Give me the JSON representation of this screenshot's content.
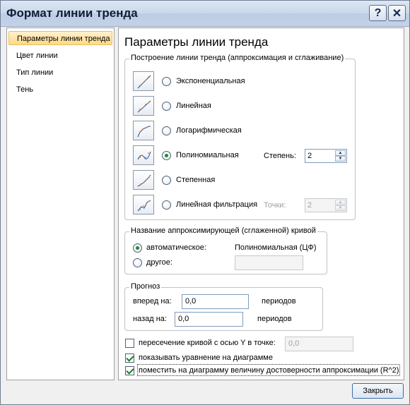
{
  "window": {
    "title": "Формат линии тренда",
    "help_label": "?",
    "close_label": "✕"
  },
  "nav": {
    "items": [
      {
        "label": "Параметры линии тренда",
        "active": true
      },
      {
        "label": "Цвет линии",
        "active": false
      },
      {
        "label": "Тип линии",
        "active": false
      },
      {
        "label": "Тень",
        "active": false
      }
    ]
  },
  "panel": {
    "title": "Параметры линии тренда",
    "build_group": {
      "legend": "Построение линии тренда (аппроксимация и сглаживание)",
      "options": [
        {
          "label": "Экспоненциальная",
          "checked": false,
          "icon": "exponential-trend-icon"
        },
        {
          "label": "Линейная",
          "checked": false,
          "icon": "linear-trend-icon"
        },
        {
          "label": "Логарифмическая",
          "checked": false,
          "icon": "logarithmic-trend-icon"
        },
        {
          "label": "Полиномиальная",
          "checked": true,
          "icon": "polynomial-trend-icon"
        },
        {
          "label": "Степенная",
          "checked": false,
          "icon": "power-trend-icon"
        },
        {
          "label": "Линейная фильтрация",
          "checked": false,
          "icon": "moving-average-trend-icon"
        }
      ],
      "degree_label": "Степень:",
      "degree_value": "2",
      "points_label": "Точки:",
      "points_value": "2"
    },
    "name_group": {
      "legend": "Название аппроксимирующей (сглаженной) кривой",
      "auto_label": "автоматическое:",
      "auto_value": "Полиномиальная (ЦФ)",
      "auto_checked": true,
      "custom_label": "другое:",
      "custom_value": ""
    },
    "forecast_group": {
      "legend": "Прогноз",
      "forward_label": "вперед на:",
      "forward_value": "0,0",
      "backward_label": "назад на:",
      "backward_value": "0,0",
      "periods_label": "периодов"
    },
    "intercept": {
      "label": "пересечение кривой с осью Y в точке:",
      "checked": false,
      "value": "0,0"
    },
    "show_equation": {
      "label": "показывать уравнение на диаграмме",
      "checked": true
    },
    "show_r2": {
      "label": "поместить на диаграмму величину достоверности аппроксимации (R^2)",
      "checked": true
    }
  },
  "footer": {
    "close_label": "Закрыть"
  }
}
